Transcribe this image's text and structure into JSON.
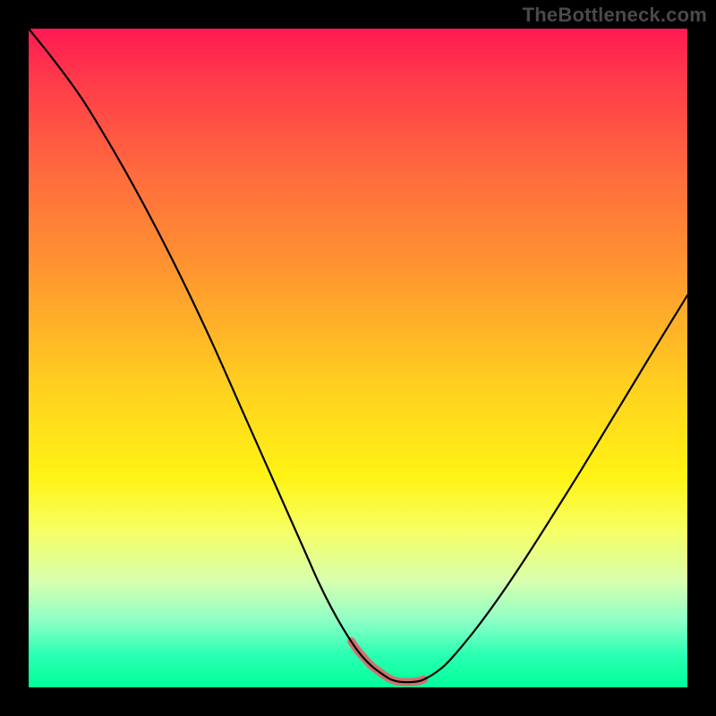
{
  "watermark": "TheBottleneck.com",
  "colors": {
    "page_bg": "#000000",
    "curve": "#000000",
    "trough_highlight": "#d96a6a",
    "gradient_top": "#ff1a52",
    "gradient_bottom": "#00ff99"
  },
  "chart_data": {
    "type": "line",
    "title": "",
    "xlabel": "",
    "ylabel": "",
    "xlim": [
      0,
      100
    ],
    "ylim": [
      0,
      100
    ],
    "grid": false,
    "legend": false,
    "series": [
      {
        "name": "curve",
        "x": [
          0,
          4,
          8,
          12,
          16,
          20,
          24,
          28,
          32,
          36,
          40,
          42,
          44,
          46,
          48,
          50,
          52,
          54,
          55,
          56,
          57,
          58,
          59,
          60,
          62,
          64,
          68,
          72,
          76,
          80,
          84,
          88,
          92,
          96,
          100
        ],
        "values": [
          100,
          95,
          89.5,
          83,
          76,
          68.5,
          60.5,
          52,
          43,
          34,
          25,
          20.5,
          16,
          12,
          8.5,
          5.5,
          3.3,
          1.8,
          1.2,
          0.9,
          0.8,
          0.8,
          0.9,
          1.2,
          2.4,
          4.2,
          9,
          14.5,
          20.5,
          26.8,
          33.2,
          39.8,
          46.4,
          53,
          59.5
        ]
      }
    ],
    "highlight_segment": {
      "name": "trough",
      "x_start": 49,
      "x_end": 60,
      "note": "red rounded segment sitting at the valley, y approximately 0.8 to 1.5"
    },
    "background_gradient": {
      "direction": "top-to-bottom",
      "stops": [
        {
          "pos": 0.0,
          "color": "#ff1a52"
        },
        {
          "pos": 0.08,
          "color": "#ff3b4a"
        },
        {
          "pos": 0.22,
          "color": "#ff6b3e"
        },
        {
          "pos": 0.38,
          "color": "#ff9a2e"
        },
        {
          "pos": 0.55,
          "color": "#ffd21f"
        },
        {
          "pos": 0.68,
          "color": "#fff314"
        },
        {
          "pos": 0.76,
          "color": "#f7ff62"
        },
        {
          "pos": 0.84,
          "color": "#d7ffb0"
        },
        {
          "pos": 0.9,
          "color": "#8bffc7"
        },
        {
          "pos": 0.95,
          "color": "#2bffb3"
        },
        {
          "pos": 1.0,
          "color": "#00ff99"
        }
      ]
    }
  }
}
